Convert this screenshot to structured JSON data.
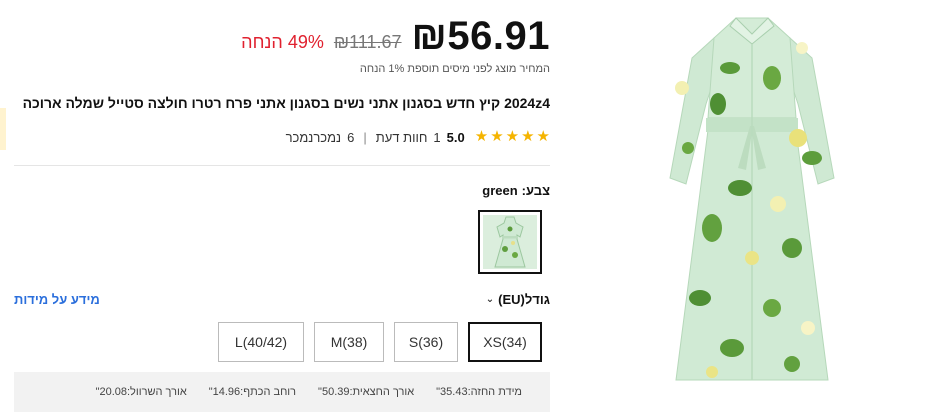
{
  "price": {
    "current": "₪56.91",
    "original": "₪111.67",
    "discount": "49% הנחה",
    "tax_note": "המחיר מוצג לפני מיסים תוספת 1% הנחה"
  },
  "product": {
    "title": "2024z4 קיץ חדש בסגנון אתני נשים בסגנון אתני פרח רטרו חולצה סטייל שמלה ארוכה",
    "rating": "5.0",
    "reviews_count": "1",
    "reviews_label": "חוות דעת",
    "sold_count": "6",
    "sold_label": "נמכרנמכר",
    "stars": 5
  },
  "color": {
    "label": "צבע:",
    "value": "green"
  },
  "size": {
    "label": "גודל(EU)",
    "guide_link": "מידע על מידות",
    "options": [
      "XS(34)",
      "S(36)",
      "M(38)",
      "L(40/42)"
    ],
    "selected": "XS(34)"
  },
  "measurements": [
    {
      "label": "מידת החזה:",
      "value": "35.43\""
    },
    {
      "label": "אורך החצאית:",
      "value": "50.39\""
    },
    {
      "label": "רוחב הכתף:",
      "value": "14.96\""
    },
    {
      "label": "אורך השרוול:",
      "value": "20.08\""
    }
  ],
  "colors": {
    "accent_red": "#e0212f",
    "link_blue": "#2b6fdc",
    "star_yellow": "#f5b400",
    "dress_green": "#cfe9d3"
  }
}
